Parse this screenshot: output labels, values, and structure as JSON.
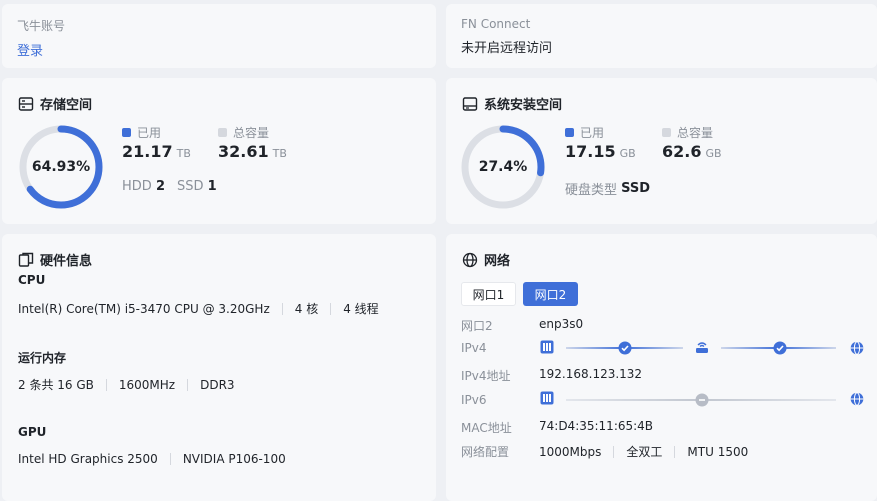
{
  "account": {
    "label": "飞牛账号",
    "action": "登录"
  },
  "fn_connect": {
    "label": "FN Connect",
    "status": "未开启远程访问"
  },
  "storage": {
    "title": "存储空间",
    "percent": "64.93%",
    "percent_value": 64.93,
    "used_label": "已用",
    "used_value": "21.17",
    "used_unit": "TB",
    "total_label": "总容量",
    "total_value": "32.61",
    "total_unit": "TB",
    "hdd_label": "HDD",
    "hdd_count": "2",
    "ssd_label": "SSD",
    "ssd_count": "1"
  },
  "system": {
    "title": "系统安装空间",
    "percent": "27.4%",
    "percent_value": 27.4,
    "used_label": "已用",
    "used_value": "17.15",
    "used_unit": "GB",
    "total_label": "总容量",
    "total_value": "62.6",
    "total_unit": "GB",
    "disk_type_label": "硬盘类型",
    "disk_type": "SSD"
  },
  "hardware": {
    "title": "硬件信息",
    "cpu_label": "CPU",
    "cpu_model": "Intel(R) Core(TM) i5-3470 CPU @ 3.20GHz",
    "cpu_cores": "4 核",
    "cpu_threads": "4 线程",
    "mem_label": "运行内存",
    "mem_size": "2 条共 16 GB",
    "mem_freq": "1600MHz",
    "mem_type": "DDR3",
    "gpu_label": "GPU",
    "gpu_1": "Intel HD Graphics 2500",
    "gpu_2": "NVIDIA P106-100"
  },
  "network": {
    "title": "网络",
    "tabs": [
      "网口1",
      "网口2"
    ],
    "active_tab": 1,
    "iface_label": "网口2",
    "iface_value": "enp3s0",
    "ipv4_label": "IPv4",
    "ipv4_addr_label": "IPv4地址",
    "ipv4_addr": "192.168.123.132",
    "ipv6_label": "IPv6",
    "mac_label": "MAC地址",
    "mac": "74:D4:35:11:65:4B",
    "config_label": "网络配置",
    "speed": "1000Mbps",
    "duplex": "全双工",
    "mtu": "MTU 1500"
  },
  "colors": {
    "accent": "#3f6fd8",
    "track": "#dcdfe5",
    "gray_square": "#d5d8de"
  }
}
